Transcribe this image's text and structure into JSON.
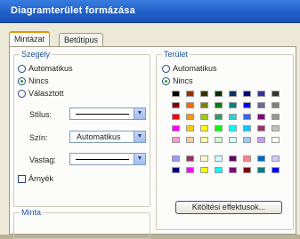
{
  "window": {
    "title": "Diagramterület formázása"
  },
  "tabs": [
    {
      "label": "Mintázat"
    },
    {
      "label": "Betűtípus"
    }
  ],
  "border": {
    "legend": "Szegély",
    "options": [
      "Automatikus",
      "Nincs",
      "Választott"
    ],
    "selected": "Nincs",
    "style_label": "Stílus:",
    "color_label": "Szín:",
    "color_value": "Automatikus",
    "weight_label": "Vastag:",
    "shadow_label": "Árnyék"
  },
  "sample": {
    "legend": "Minta"
  },
  "area": {
    "legend": "Terület",
    "options": [
      "Automatikus",
      "Nincs"
    ],
    "selected": "Nincs",
    "palette": [
      [
        "#000000",
        "#993300",
        "#333300",
        "#003300",
        "#003366",
        "#000080",
        "#333399",
        "#333333"
      ],
      [
        "#800000",
        "#ff6600",
        "#808000",
        "#008000",
        "#008080",
        "#0000ff",
        "#666699",
        "#808080"
      ],
      [
        "#ff0000",
        "#ff9900",
        "#99cc00",
        "#339966",
        "#33cccc",
        "#3366ff",
        "#800080",
        "#969696"
      ],
      [
        "#ff00ff",
        "#ffcc00",
        "#ffff00",
        "#00ff00",
        "#00ffff",
        "#00ccff",
        "#993366",
        "#c0c0c0"
      ],
      [
        "#ff99cc",
        "#ffcc99",
        "#ffff99",
        "#ccffcc",
        "#ccffff",
        "#99ccff",
        "#cc99ff",
        "#ffffff"
      ],
      [
        "#9999ff",
        "#993366",
        "#ffffcc",
        "#ccffff",
        "#660066",
        "#ff8080",
        "#0066cc",
        "#ccccff"
      ],
      [
        "#000080",
        "#ff00ff",
        "#ffff00",
        "#00ffff",
        "#800080",
        "#800000",
        "#008080",
        "#0000ff"
      ]
    ],
    "fill_effects_button": "Kitöltési effektusok..."
  }
}
